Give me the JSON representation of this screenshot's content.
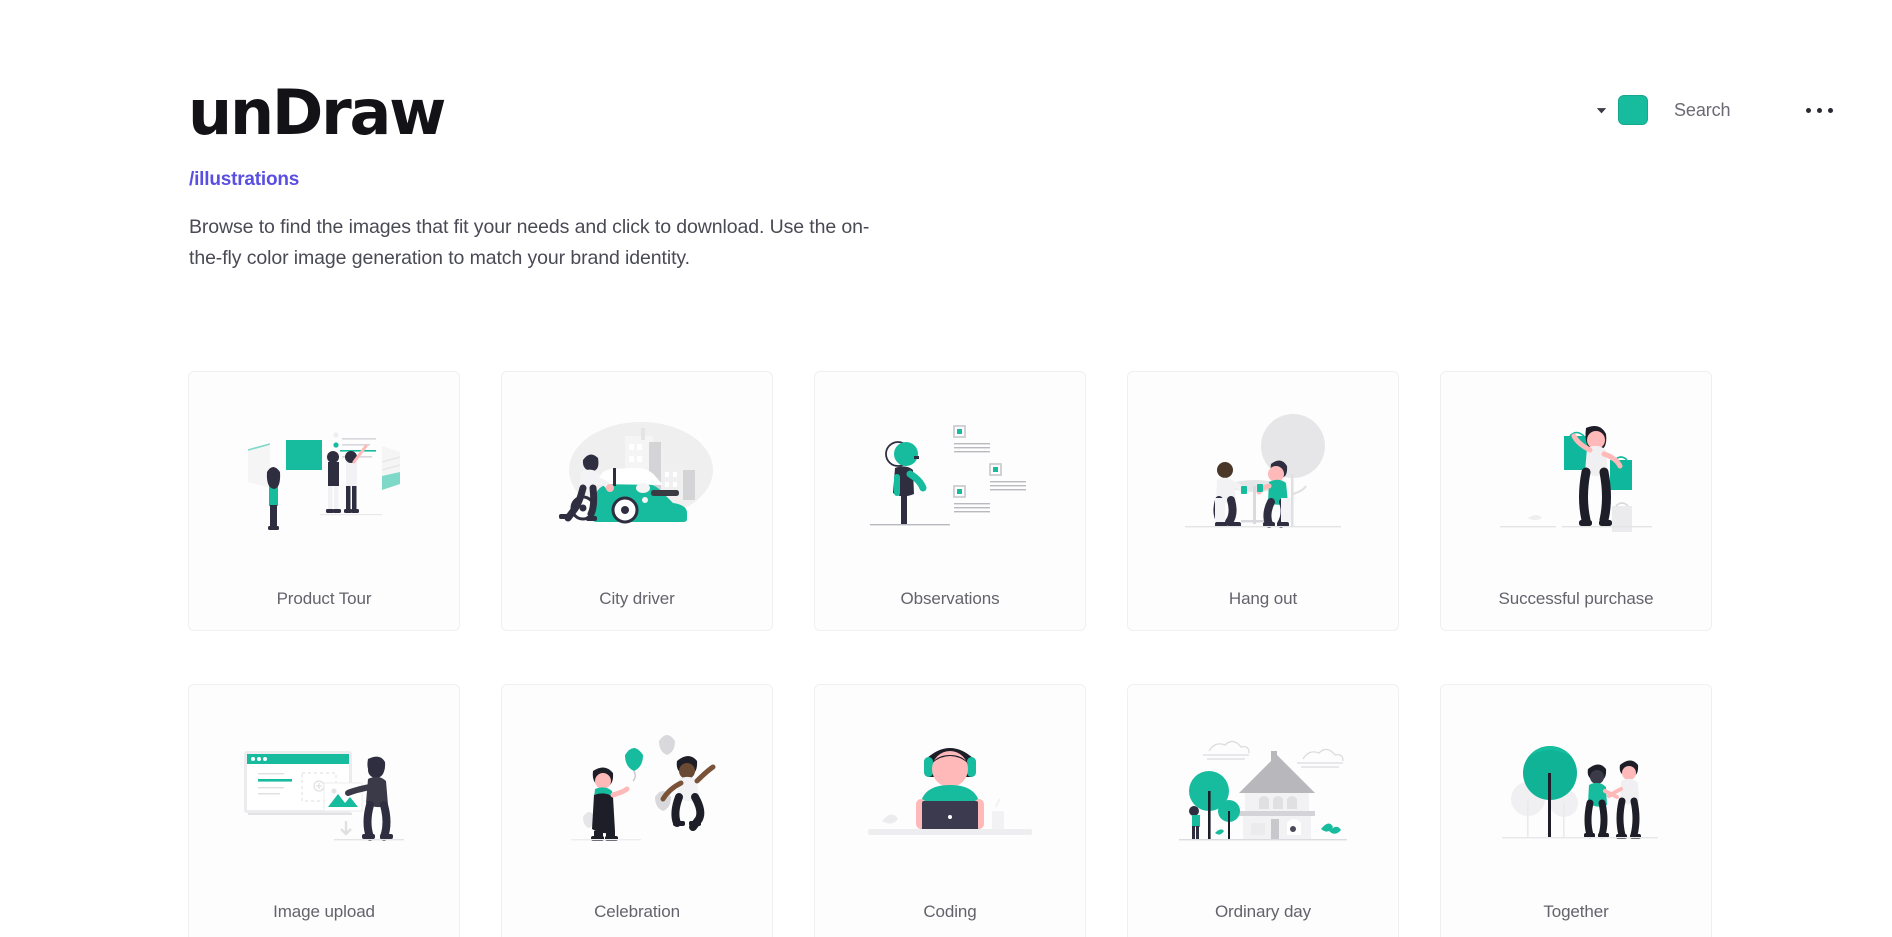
{
  "header": {
    "brand": "unDraw",
    "breadcrumb": "/illustrations",
    "intro": "Browse to find the images that fit your needs and click to download. Use the on-the-fly color image generation to match your brand identity."
  },
  "controls": {
    "chevron_icon": "chevron-down-icon",
    "color_swatch": {
      "icon": "color-swatch-icon",
      "value": "#17BC9F"
    },
    "search": {
      "icon": "search-input",
      "value": "",
      "placeholder": "Search"
    },
    "more_menu": {
      "icon": "ellipsis-icon",
      "label": "..."
    }
  },
  "colors": {
    "accent_teal": "#17BC9F",
    "link_indigo": "#5A4FE0",
    "text_dark": "#121217",
    "text_body": "#4A4A55",
    "label_gray": "#63636C",
    "card_border": "#F0F0F2",
    "illustration_gray": "#E6E6E8",
    "illustration_dark": "#2F2E41",
    "skin_tone": "#FFB9B9"
  },
  "grid": {
    "cards": [
      {
        "label": "Product Tour",
        "art": "product-tour"
      },
      {
        "label": "City driver",
        "art": "city-driver"
      },
      {
        "label": "Observations",
        "art": "observations"
      },
      {
        "label": "Hang out",
        "art": "hang-out"
      },
      {
        "label": "Successful purchase",
        "art": "successful-purchase"
      },
      {
        "label": "Image upload",
        "art": "image-upload"
      },
      {
        "label": "Celebration",
        "art": "celebration"
      },
      {
        "label": "Coding",
        "art": "coding"
      },
      {
        "label": "Ordinary day",
        "art": "ordinary-day"
      },
      {
        "label": "Together",
        "art": "together"
      }
    ]
  }
}
